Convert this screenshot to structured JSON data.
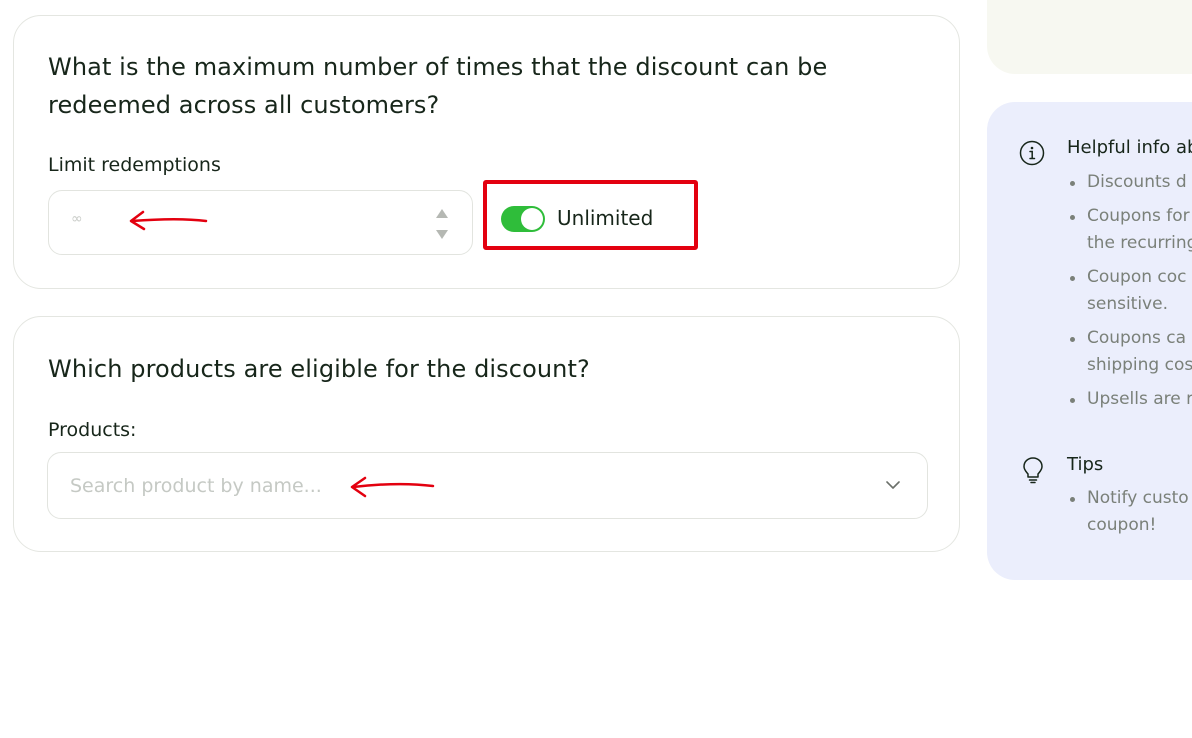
{
  "redemptions_card": {
    "title": "What is the maximum number of times that the discount can be redeemed across all customers?",
    "limit_label": "Limit redemptions",
    "limit_placeholder": "∞",
    "toggle_label": "Unlimited",
    "toggle_on": true
  },
  "products_card": {
    "title": "Which products are eligible for the discount?",
    "products_label": "Products:",
    "search_placeholder": "Search product by name..."
  },
  "info_panel": {
    "heading": "Helpful info ab",
    "items": [
      "Discounts d",
      "Coupons for\nthe recurring",
      "Coupon coc\nsensitive.",
      "Coupons ca\nshipping cos",
      "Upsells are r"
    ],
    "tips_heading": "Tips",
    "tips_items": [
      "Notify custo\ncoupon!"
    ]
  },
  "colors": {
    "toggle_on": "#2fbd3a",
    "annotation_red": "#e3000f",
    "info_bg": "#ebeefc"
  },
  "icons": [
    "info-icon",
    "lightbulb-icon",
    "chevron-down-icon",
    "spin-arrows-icon"
  ]
}
